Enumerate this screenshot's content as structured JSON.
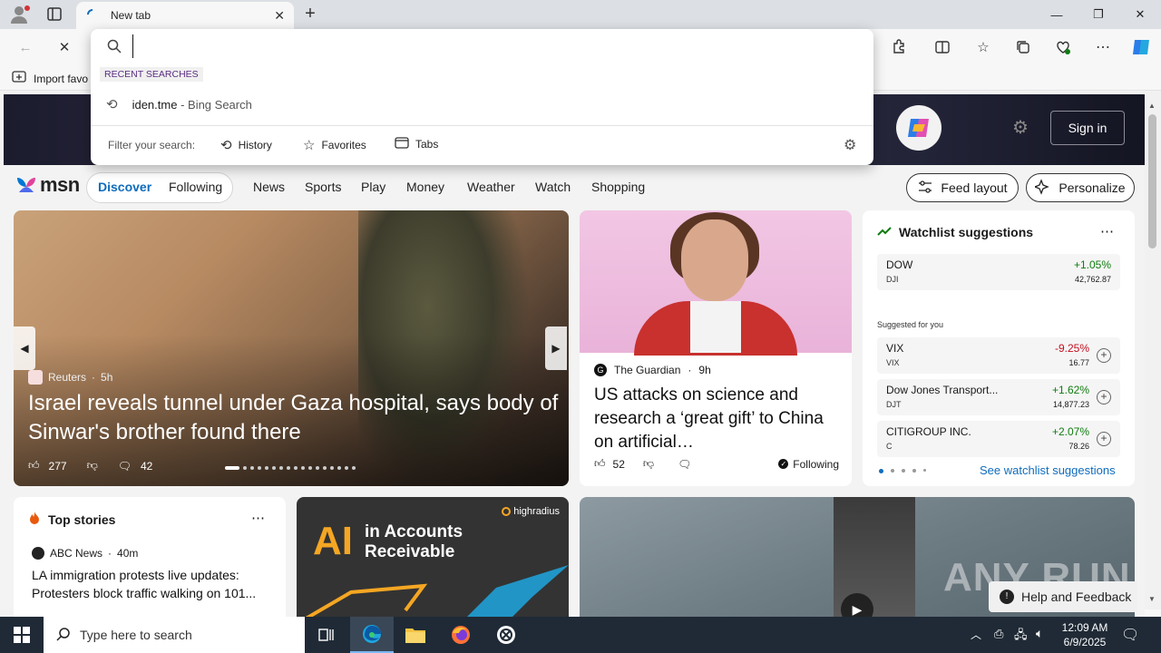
{
  "browser": {
    "tab_title": "New tab",
    "favorites_bar_item": "Import favo"
  },
  "omnibox": {
    "input_value": "",
    "recent_header": "RECENT SEARCHES",
    "recent": [
      {
        "query": "iden.tme",
        "engine": "- Bing Search"
      }
    ],
    "filter_label": "Filter your search:",
    "filters": [
      "History",
      "Favorites",
      "Tabs"
    ]
  },
  "msn": {
    "logo": "msn",
    "sign_in": "Sign in",
    "pill_tabs": [
      "Discover",
      "Following"
    ],
    "nav": [
      "News",
      "Sports",
      "Play",
      "Money",
      "Weather",
      "Watch",
      "Shopping"
    ],
    "feed_layout": "Feed layout",
    "personalize": "Personalize"
  },
  "hero": {
    "source": "Reuters",
    "time": "5h",
    "headline": "Israel reveals tunnel under Gaza hospital, says body of Sinwar's brother found there",
    "likes": "277",
    "comments": "42"
  },
  "guardian": {
    "source": "The Guardian",
    "time": "9h",
    "headline": "US attacks on science and research a ‘great gift’ to China on artificial…",
    "likes": "52",
    "following": "Following"
  },
  "watchlist": {
    "title": "Watchlist suggestions",
    "main": {
      "name": "DOW",
      "symbol": "DJI",
      "change": "+1.05%",
      "value": "42,762.87"
    },
    "suggested_label": "Suggested for you",
    "items": [
      {
        "name": "VIX",
        "symbol": "VIX",
        "change": "-9.25%",
        "value": "16.77"
      },
      {
        "name": "Dow Jones Transport...",
        "symbol": "DJT",
        "change": "+1.62%",
        "value": "14,877.23"
      },
      {
        "name": "CITIGROUP INC.",
        "symbol": "C",
        "change": "+2.07%",
        "value": "78.26"
      }
    ],
    "see_more": "See watchlist suggestions"
  },
  "top_stories": {
    "title": "Top stories",
    "source": "ABC News",
    "time": "40m",
    "headline": "LA immigration protests live updates: Protesters block traffic walking on 101..."
  },
  "ad": {
    "brand": "highradius",
    "big": "AI",
    "line1": "in Accounts",
    "line2": "Receivable"
  },
  "feedback": "Help and Feedback",
  "watermark": "ANY RUN",
  "taskbar": {
    "search_placeholder": "Type here to search",
    "time": "12:09 AM",
    "date": "6/9/2025"
  },
  "colors": {
    "accent": "#0f6cbd",
    "positive": "#107c10",
    "negative": "#c50f1f",
    "taskbar": "#1f2a36"
  }
}
